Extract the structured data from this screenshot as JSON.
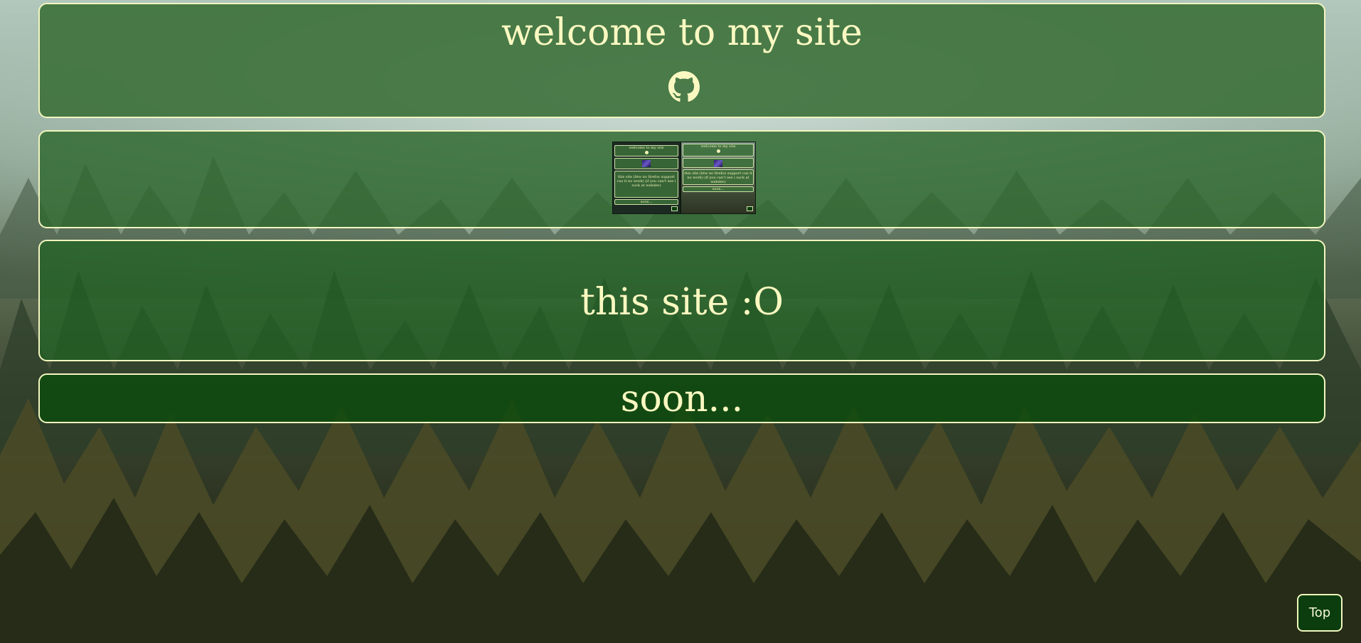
{
  "hero": {
    "title": "welcome to my site",
    "icon": "github-icon"
  },
  "gallery": {
    "thumbnails": [
      {
        "title": "welcome to my site",
        "body": "this site (btw no firefox support cuz it no work) (if you can't see i suck at webdev)",
        "footer": "soon..."
      },
      {
        "title": "welcome to my site",
        "body": "this site (btw no firefox support cuz it no work) (if you can't see i suck at webdev)",
        "footer": "soon..."
      }
    ]
  },
  "section": {
    "title": "this site :O"
  },
  "upcoming": {
    "title": "soon..."
  },
  "nav": {
    "top_label": "Top"
  },
  "colors": {
    "panel_green": "#3c703a",
    "border_cream": "#f2f6bf",
    "text_cream": "#fbf8c1",
    "button_green": "#0b3d0e"
  }
}
